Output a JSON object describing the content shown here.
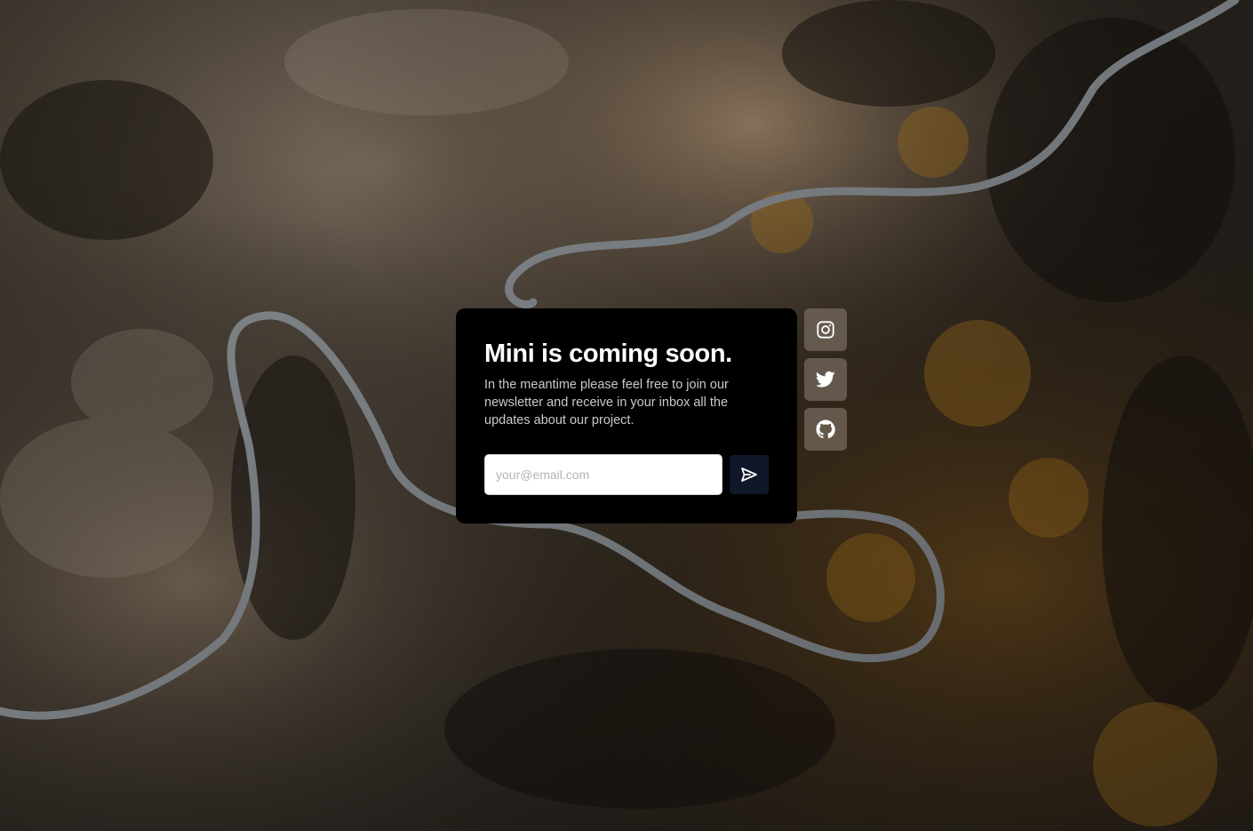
{
  "hero": {
    "title": "Mini is coming soon.",
    "description": "In the meantime please feel free to join our newsletter and receive in your inbox all the updates about our project."
  },
  "newsletter": {
    "email_placeholder": "your@email.com",
    "email_value": "",
    "submit_icon": "send-icon"
  },
  "social_links": [
    {
      "name": "Instagram",
      "icon": "instagram-icon"
    },
    {
      "name": "Twitter",
      "icon": "twitter-icon"
    },
    {
      "name": "GitHub",
      "icon": "github-icon"
    }
  ],
  "background": {
    "description_icon": "aerial-mountain-road-image"
  },
  "colors": {
    "card_background": "#000000",
    "title_text": "#ffffff",
    "body_text": "#c9c9c9",
    "send_button": "#0f1729",
    "social_button": "#786c60"
  }
}
